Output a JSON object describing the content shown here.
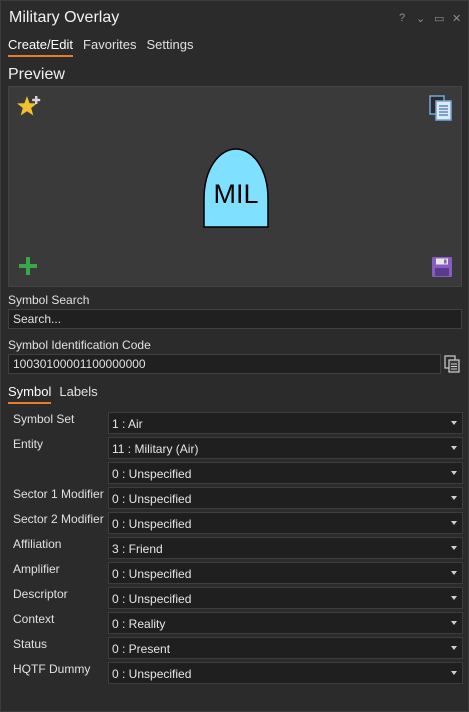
{
  "window": {
    "title": "Military Overlay",
    "controls": {
      "help": "?",
      "menu": "⌄",
      "restore": "▭",
      "close": "✕"
    }
  },
  "tabs": [
    {
      "label": "Create/Edit",
      "active": true
    },
    {
      "label": "Favorites",
      "active": false
    },
    {
      "label": "Settings",
      "active": false
    }
  ],
  "preview": {
    "label": "Preview",
    "symbol_text": "MIL",
    "symbol_fill": "#80e0ff",
    "icons": {
      "add_favorite": "star-plus-icon",
      "copy": "copy-document-icon",
      "add": "plus-icon",
      "save": "save-disk-icon"
    }
  },
  "search": {
    "label": "Symbol Search",
    "placeholder": "Search..."
  },
  "sidc": {
    "label": "Symbol Identification Code",
    "value": "10030100001100000000"
  },
  "subtabs": [
    {
      "label": "Symbol",
      "active": true
    },
    {
      "label": "Labels",
      "active": false
    }
  ],
  "fields": [
    {
      "label": "Symbol Set",
      "value": "1 : Air"
    },
    {
      "label": "Entity",
      "value": "11 : Military (Air)"
    },
    {
      "label": "",
      "value": "0 : Unspecified"
    },
    {
      "label": "Sector 1 Modifier",
      "value": "0 : Unspecified"
    },
    {
      "label": "Sector 2 Modifier",
      "value": "0 : Unspecified"
    },
    {
      "label": "Affiliation",
      "value": "3 : Friend"
    },
    {
      "label": "Amplifier",
      "value": "0 : Unspecified"
    },
    {
      "label": "Descriptor",
      "value": "0 : Unspecified"
    },
    {
      "label": "Context",
      "value": "0 : Reality"
    },
    {
      "label": "Status",
      "value": "0 : Present"
    },
    {
      "label": "HQTF Dummy",
      "value": "0 : Unspecified"
    }
  ],
  "colors": {
    "accent": "#e97c2c",
    "star": "#f0c030",
    "plus": "#3aa64a",
    "save": "#8a5cc0"
  }
}
